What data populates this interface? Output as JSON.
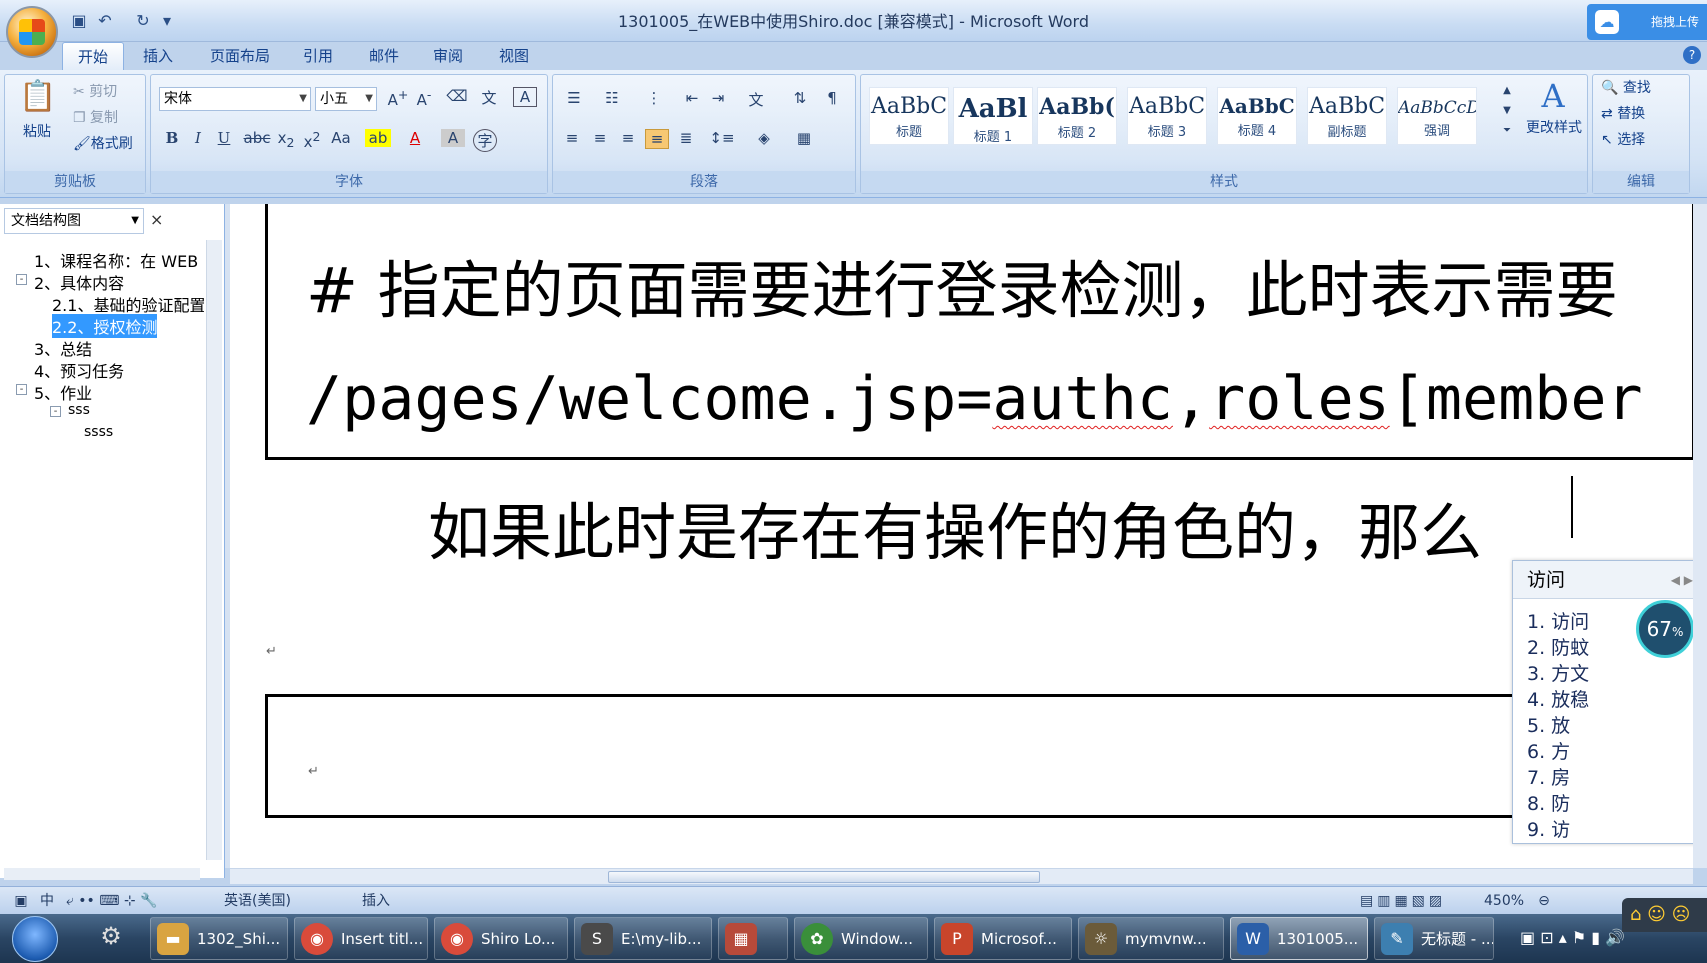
{
  "window": {
    "title": "1301005_在WEB中使用Shiro.doc [兼容模式] - Microsoft Word",
    "upload_label": "拖拽上传"
  },
  "tabs": [
    "开始",
    "插入",
    "页面布局",
    "引用",
    "邮件",
    "审阅",
    "视图"
  ],
  "ribbon": {
    "clipboard": {
      "paste": "粘贴",
      "cut": "剪切",
      "copy": "复制",
      "format_painter": "格式刷",
      "label": "剪贴板"
    },
    "font": {
      "name": "宋体",
      "size": "小五",
      "label": "字体"
    },
    "paragraph": {
      "label": "段落"
    },
    "styles": {
      "items": [
        {
          "sample": "AaBbC",
          "name": "标题"
        },
        {
          "sample": "AaBl",
          "name": "标题 1"
        },
        {
          "sample": "AaBb(",
          "name": "标题 2"
        },
        {
          "sample": "AaBbC",
          "name": "标题 3"
        },
        {
          "sample": "AaBbC",
          "name": "标题 4"
        },
        {
          "sample": "AaBbC",
          "name": "副标题"
        },
        {
          "sample": "AaBbCcD",
          "name": "强调"
        }
      ],
      "change_styles": "更改样式",
      "label": "样式"
    },
    "editing": {
      "find": "查找",
      "replace": "替换",
      "select": "选择",
      "label": "编辑"
    }
  },
  "nav": {
    "title": "文档结构图",
    "items": [
      "1、课程名称：在 WEB",
      "2、具体内容",
      "2.1、基础的验证配置",
      "2.2、授权检测",
      "3、总结",
      "4、预习任务",
      "5、作业",
      "sss",
      "ssss"
    ]
  },
  "document": {
    "line1": "# 指定的页面需要进行登录检测，此时表示需要",
    "line2_prefix": "/pages/welcome.jsp=",
    "line2_err1": "authc",
    "line2_sep": ",",
    "line2_err2": "roles",
    "line2_suffix": "[member",
    "line3": "如果此时是存在有操作的角色的，那么",
    "para_mark": "↵"
  },
  "ime": {
    "input": "访问",
    "candidates": [
      "1. 访问",
      "2. 防蚊",
      "3. 方文",
      "4. 放稳",
      "5. 放",
      "6. 方",
      "7. 房",
      "8. 防",
      "9. 访"
    ],
    "zoom": "67"
  },
  "status": {
    "language": "英语(美国)",
    "mode": "插入",
    "zoom": "450%",
    "input_mode": "中"
  },
  "taskbar": [
    {
      "label": "1302_Shi...",
      "color": "#d9a441"
    },
    {
      "label": "Insert titl...",
      "color": "#d94b3b"
    },
    {
      "label": "Shiro Lo...",
      "color": "#d94b3b"
    },
    {
      "label": "E:\\my-lib...",
      "color": "#4a4a4a"
    },
    {
      "label": "",
      "color": "#b74a3a"
    },
    {
      "label": "Window...",
      "color": "#3a8f3a"
    },
    {
      "label": "Microsof...",
      "color": "#c8452b"
    },
    {
      "label": "mymvnw...",
      "color": "#6b5b3a"
    },
    {
      "label": "1301005...",
      "color": "#2b5fa8"
    },
    {
      "label": "无标题 - ...",
      "color": "#3d7fb0"
    }
  ]
}
